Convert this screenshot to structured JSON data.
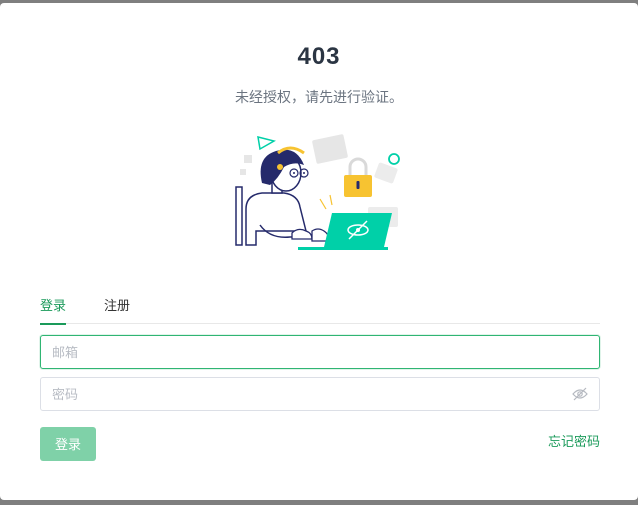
{
  "error": {
    "code": "403",
    "message": "未经授权，请先进行验证。"
  },
  "tabs": [
    {
      "label": "登录",
      "active": true
    },
    {
      "label": "注册",
      "active": false
    }
  ],
  "form": {
    "email": {
      "placeholder": "邮箱",
      "value": ""
    },
    "password": {
      "placeholder": "密码",
      "value": "",
      "toggle_icon": "eye-slash-icon"
    },
    "login_label": "登录",
    "forgot_label": "忘记密码"
  },
  "colors": {
    "accent": "#1a9a5a",
    "button_disabled": "#7fd1a8",
    "illustration_teal": "#00d0a8",
    "illustration_yellow": "#f7c331",
    "illustration_navy": "#252a6b"
  },
  "illustration": {
    "icon": "unauthorized-illustration"
  }
}
